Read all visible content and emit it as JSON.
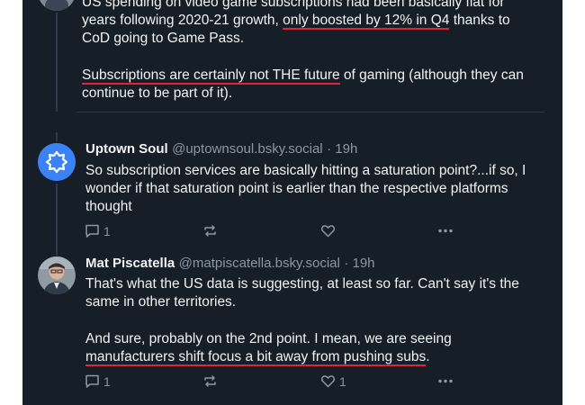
{
  "post1": {
    "line1": "US spending on video game subscriptions had been basically flat for",
    "line2_pre": "years following 2020-21 growth, ",
    "line2_hl": "only boosted by 12% in Q4",
    "line2_post": " thanks to",
    "line3": "CoD going to Game Pass.",
    "line4_hl": "Subscriptions are certainly not THE future",
    "line4_post": " of gaming (although they can",
    "line5": "continue to be part of it)."
  },
  "post2": {
    "name": "Uptown Soul",
    "handle": "@uptownsoul.bsky.social",
    "time": "· 19h",
    "line1": "So subscription services are basically hitting a saturation point?...if so, I",
    "line2": "wonder if that saturation point is earlier than the respective platforms",
    "line3": "thought",
    "reply_count": "1",
    "like_count": ""
  },
  "post3": {
    "name": "Mat Piscatella",
    "handle": "@matpiscatella.bsky.social",
    "time": "· 19h",
    "line1": "That's what the US data is suggesting, at least so far. Can't say it's the",
    "line2": "same in other territories.",
    "line3": "And sure, probably on the 2nd point. I mean, we are seeing",
    "line4_hl": "manufacturers shift focus a bit away from pushing subs",
    "line4_post": ".",
    "reply_count": "1",
    "like_count": "1"
  },
  "colors": {
    "background": "#161e27",
    "text": "#f1f3f5",
    "muted": "#8b98a5",
    "underline": "#e0243a",
    "avatar_blue": "#3b82f6"
  },
  "icons": [
    "reply-icon",
    "repost-icon",
    "like-icon",
    "more-icon",
    "shield-badge-icon"
  ]
}
